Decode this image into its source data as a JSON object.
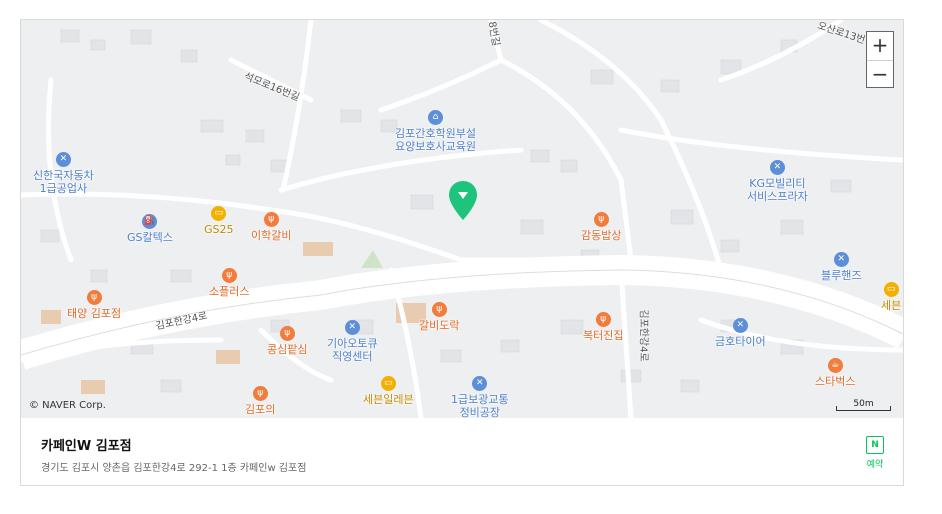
{
  "map": {
    "zoom_in_label": "+",
    "zoom_out_label": "−",
    "copyright": "© NAVER Corp.",
    "scale_label": "50m",
    "road_labels": {
      "top_right": "오산로13번",
      "top_mid": "8번길",
      "seokmo": "석모로16번길",
      "gimpohangang_left": "김포한강4로",
      "gimpohangang_vertical": "김포한강4로"
    },
    "pois": [
      {
        "label": "김포간호학원부설",
        "label2": "요양보호사교육원",
        "kind": "blue",
        "icon": "school-icon"
      },
      {
        "label": "신한국자동차",
        "label2": "1급공업사",
        "kind": "blue",
        "icon": "wrench-icon"
      },
      {
        "label": "GS칼텍스",
        "kind": "blue",
        "icon": "gas-station-icon"
      },
      {
        "label": "GS25",
        "kind": "gold",
        "icon": "convenience-store-icon"
      },
      {
        "label": "이학갈비",
        "kind": "orange",
        "icon": "restaurant-icon"
      },
      {
        "label": "감동밥상",
        "kind": "orange",
        "icon": "restaurant-icon"
      },
      {
        "label": "KG모빌리티",
        "label2": "서비스프라자",
        "kind": "blue",
        "icon": "wrench-icon"
      },
      {
        "label": "블루핸즈",
        "kind": "blue",
        "icon": "wrench-icon"
      },
      {
        "label": "세븐",
        "kind": "gold",
        "icon": "convenience-store-icon"
      },
      {
        "label": "소플러스",
        "kind": "orange",
        "icon": "restaurant-icon"
      },
      {
        "label": "태양 김포점",
        "kind": "orange",
        "icon": "restaurant-icon"
      },
      {
        "label": "갈비도락",
        "kind": "orange",
        "icon": "restaurant-icon"
      },
      {
        "label": "복터진집",
        "kind": "orange",
        "icon": "restaurant-icon"
      },
      {
        "label": "콩심팥심",
        "kind": "orange",
        "icon": "restaurant-icon"
      },
      {
        "label": "기아오토큐",
        "label2": "직영센터",
        "kind": "blue",
        "icon": "wrench-icon"
      },
      {
        "label": "금호타이어",
        "kind": "blue",
        "icon": "wrench-icon"
      },
      {
        "label": "스타벅스",
        "kind": "orange",
        "icon": "cafe-icon"
      },
      {
        "label": "세븐일레븐",
        "kind": "gold",
        "icon": "convenience-store-icon"
      },
      {
        "label": "1급보광교통",
        "label2": "정비공장",
        "kind": "blue",
        "icon": "wrench-icon"
      },
      {
        "label": "김포의",
        "kind": "orange",
        "icon": "restaurant-icon"
      }
    ]
  },
  "place": {
    "name": "카페인W 김포점",
    "address": "경기도 김포시 양촌읍 김포한강4로 292-1 1층 카페인w 김포점",
    "reserve_icon": "N",
    "reserve_label": "예약"
  },
  "colors": {
    "map_bg": "#eeeff1",
    "road": "#ffffff",
    "marker": "#1ec47b",
    "naver_green": "#03c75a"
  }
}
